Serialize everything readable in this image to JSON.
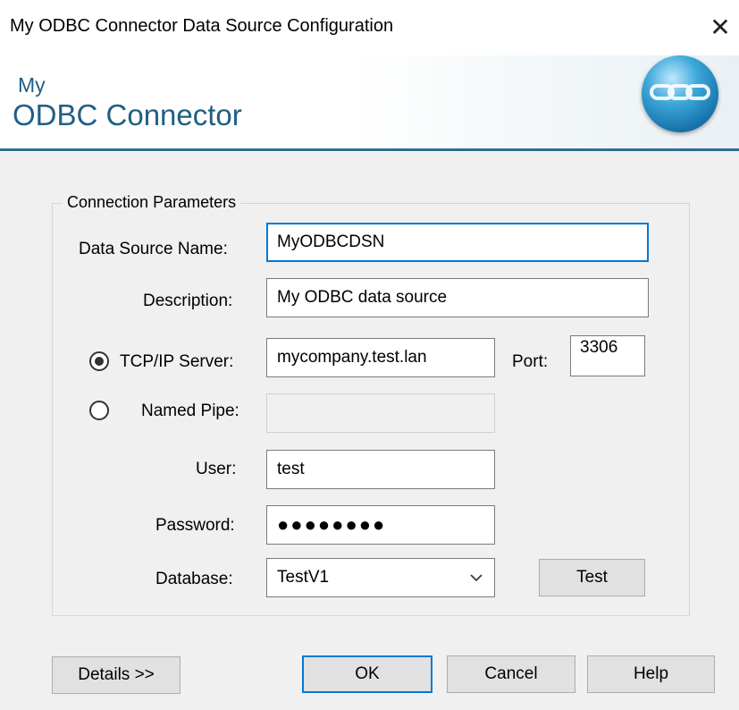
{
  "window": {
    "title": "My ODBC Connector Data Source Configuration",
    "close_glyph": "✕"
  },
  "banner": {
    "logo_line1": "My",
    "logo_line2": "ODBC Connector",
    "logo_icon": "chain-link-orb-icon",
    "accent_color": "#1f5f82"
  },
  "group": {
    "title": "Connection Parameters"
  },
  "form": {
    "dsn": {
      "label": "Data Source Name:",
      "value": "MyODBCDSN"
    },
    "description": {
      "label": "Description:",
      "value": "My ODBC data source"
    },
    "tcp": {
      "label": "TCP/IP Server:",
      "value": "mycompany.test.lan",
      "selected": true
    },
    "port": {
      "label": "Port:",
      "value": "3306"
    },
    "pipe": {
      "label": "Named Pipe:",
      "value": "",
      "selected": false
    },
    "user": {
      "label": "User:",
      "value": "test"
    },
    "password": {
      "label": "Password:",
      "value": "●●●●●●●●"
    },
    "database": {
      "label": "Database:",
      "value": "TestV1",
      "dropdown_icon": "chevron-down-icon"
    }
  },
  "buttons": {
    "test": "Test",
    "details": "Details >>",
    "ok": "OK",
    "cancel": "Cancel",
    "help": "Help"
  }
}
